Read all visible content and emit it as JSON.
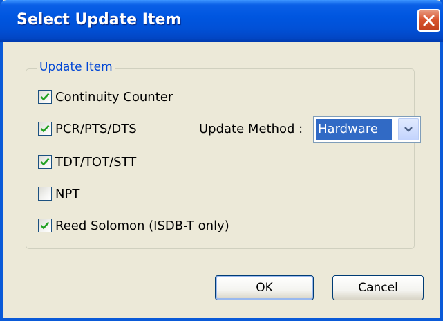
{
  "dialog": {
    "title": "Select Update Item",
    "close_icon": "close-icon"
  },
  "group": {
    "legend": "Update Item",
    "items": [
      {
        "label": "Continuity Counter",
        "checked": true
      },
      {
        "label": "PCR/PTS/DTS",
        "checked": true
      },
      {
        "label": "TDT/TOT/STT",
        "checked": true
      },
      {
        "label": "NPT",
        "checked": false
      },
      {
        "label": "Reed Solomon (ISDB-T only)",
        "checked": true
      }
    ]
  },
  "update_method": {
    "label": "Update Method :",
    "selected": "Hardware",
    "arrow_icon": "chevron-down-icon"
  },
  "buttons": {
    "ok": "OK",
    "cancel": "Cancel"
  },
  "colors": {
    "title_bar": "#0056e0",
    "legend_text": "#0046d5",
    "selection": "#316ac5",
    "check": "#21a121",
    "close_button": "#d9552f"
  }
}
